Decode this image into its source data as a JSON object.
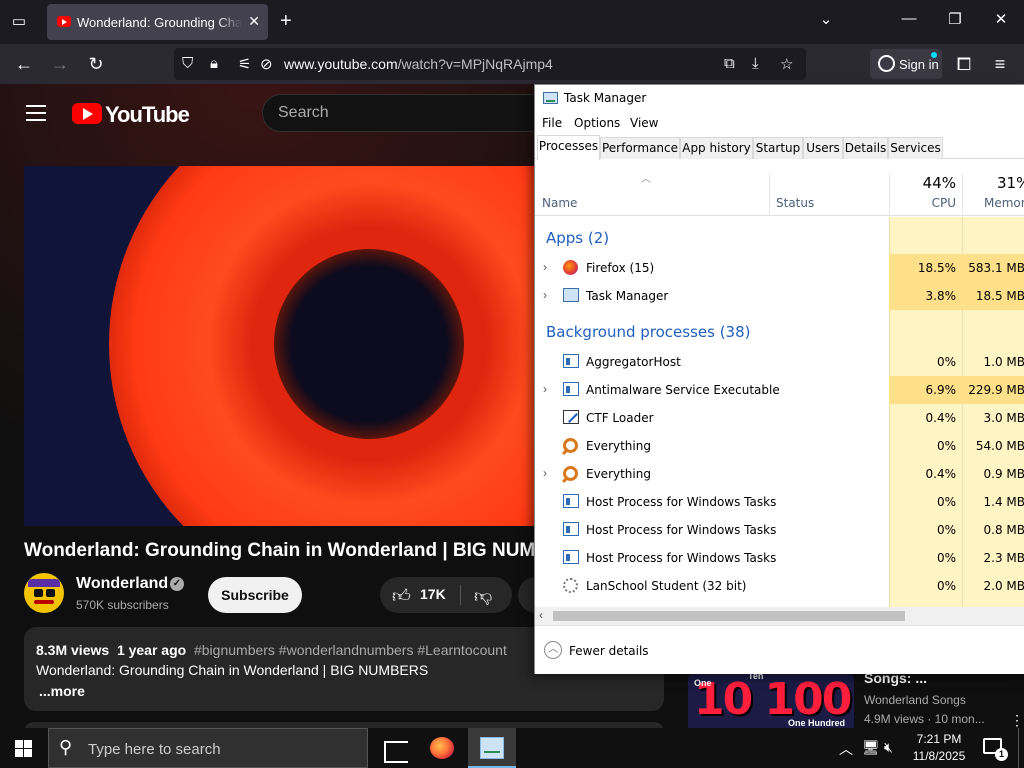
{
  "browser": {
    "tab_title": "Wonderland: Grounding Chain in Wonderland | BIG NUMBERS",
    "url_domain": "www.youtube.com",
    "url_path": "/watch?v=MPjNqRAjmp4",
    "sign_in_label": "Sign in"
  },
  "youtube": {
    "logo_text": "YouTube",
    "search_placeholder": "Search",
    "video_title": "Wonderland: Grounding Chain in Wonderland | BIG NUMBERS",
    "channel_name": "Wonderland",
    "subscribers": "570K subscribers",
    "subscribe_label": "Subscribe",
    "likes": "17K",
    "description": {
      "views": "8.3M views",
      "age": "1 year ago",
      "hashtags": "#bignumbers #wonderlandnumbers #Learntocount",
      "text": "Wonderland: Grounding Chain in Wonderland | BIG NUMBERS",
      "more_label": "...more"
    },
    "recommended": {
      "title": "Songs: ...",
      "channel": "Wonderland Songs",
      "stats": "4.9M views · 10 mon...",
      "thumb_big_text": "10 100",
      "thumb_labels": [
        "One",
        "Ten",
        "One Hundred"
      ]
    }
  },
  "task_manager": {
    "title": "Task Manager",
    "menu": [
      "File",
      "Options",
      "View"
    ],
    "tabs": [
      "Processes",
      "Performance",
      "App history",
      "Startup",
      "Users",
      "Details",
      "Services"
    ],
    "active_tab": "Processes",
    "columns": {
      "name": "Name",
      "status": "Status",
      "cpu_total": "44%",
      "cpu_label": "CPU",
      "mem_total": "31%",
      "mem_label": "Memory"
    },
    "apps_group": "Apps (2)",
    "apps": [
      {
        "name": "Firefox (15)",
        "cpu": "18.5%",
        "mem": "583.1 MB"
      },
      {
        "name": "Task Manager",
        "cpu": "3.8%",
        "mem": "18.5 MB"
      }
    ],
    "bg_group": "Background processes (38)",
    "background": [
      {
        "name": "AggregatorHost",
        "cpu": "0%",
        "mem": "1.0 MB"
      },
      {
        "name": "Antimalware Service Executable",
        "cpu": "6.9%",
        "mem": "229.9 MB"
      },
      {
        "name": "CTF Loader",
        "cpu": "0.4%",
        "mem": "3.0 MB"
      },
      {
        "name": "Everything",
        "cpu": "0%",
        "mem": "54.0 MB"
      },
      {
        "name": "Everything",
        "cpu": "0.4%",
        "mem": "0.9 MB"
      },
      {
        "name": "Host Process for Windows Tasks",
        "cpu": "0%",
        "mem": "1.4 MB"
      },
      {
        "name": "Host Process for Windows Tasks",
        "cpu": "0%",
        "mem": "0.8 MB"
      },
      {
        "name": "Host Process for Windows Tasks",
        "cpu": "0%",
        "mem": "2.3 MB"
      },
      {
        "name": "LanSchool Student (32 bit)",
        "cpu": "0%",
        "mem": "2.0 MB"
      }
    ],
    "fewer_details_label": "Fewer details"
  },
  "taskbar": {
    "search_placeholder": "Type here to search",
    "time": "7:21 PM",
    "date": "11/8/2025",
    "notification_count": "1"
  }
}
